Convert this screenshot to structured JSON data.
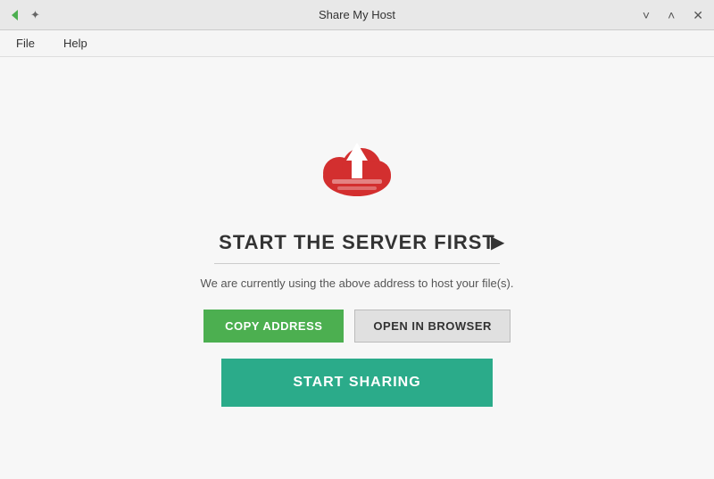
{
  "titlebar": {
    "title": "Share My Host",
    "minimize_label": "─",
    "restore_label": "□",
    "close_label": "✕",
    "chevron_down": "˅",
    "chevron_up": "˄"
  },
  "menubar": {
    "file_label": "File",
    "help_label": "Help"
  },
  "main": {
    "heading": "START THE SERVER FIRST",
    "subtitle": "We are currently using the above address to host your file(s).",
    "copy_button": "COPY ADDRESS",
    "browser_button": "OPEN IN BROWSER",
    "start_button": "START SHARING"
  }
}
